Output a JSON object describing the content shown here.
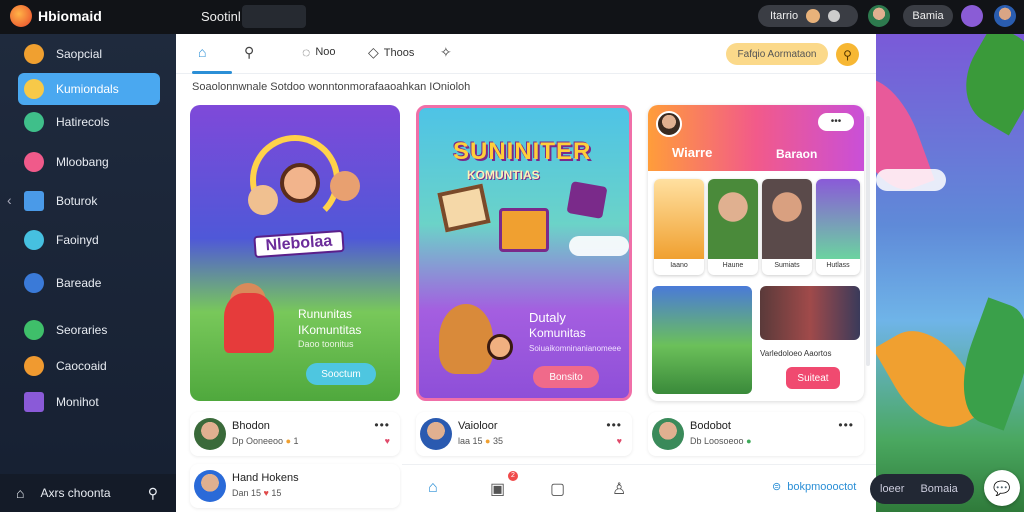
{
  "topbar": {
    "app_name": "Hbiomaid",
    "search_label": "Sootinl",
    "profile_pill": "Itarrio",
    "pill2": "Bamia"
  },
  "sidebar": {
    "items": [
      {
        "label": "Saopcial",
        "color": "#f0a030"
      },
      {
        "label": "Kumiondals",
        "color": "#f7c948"
      },
      {
        "label": "Hatirecols",
        "color": "#3fbf8a"
      },
      {
        "label": "Mloobang",
        "color": "#f05a8a"
      },
      {
        "label": "Boturok",
        "color": "#4a9ae8"
      },
      {
        "label": "Faoinyd",
        "color": "#46c0e0"
      },
      {
        "label": "Bareade",
        "color": "#3a7ad8"
      },
      {
        "label": "Seoraries",
        "color": "#3fbf6a"
      },
      {
        "label": "Caocoaid",
        "color": "#f09a30"
      },
      {
        "label": "Monihot",
        "color": "#8a5ad8"
      }
    ],
    "bottom_label": "Axrs choonta"
  },
  "tabs": [
    {
      "label": "",
      "icon": "home-icon"
    },
    {
      "label": "",
      "icon": "search-icon"
    },
    {
      "label": "Noo",
      "icon": "chat-icon"
    },
    {
      "label": "Thoos",
      "icon": "comment-icon"
    },
    {
      "label": "",
      "icon": "sparkle-icon"
    }
  ],
  "header_right": {
    "yellow_pill": "Fafqio Aormataon"
  },
  "subheading": "Soaolonnwnale Sotdoo wonntonmorafaaoahkan IOnioloh",
  "cards": {
    "card1": {
      "title": "Nlebolaa",
      "line1": "Rununitas",
      "line2": "IKomuntitas",
      "line3": "Daoo toonitus",
      "button": "Sooctum"
    },
    "card2": {
      "title": "SUNINITER",
      "subtitle": "KOMUNTIAS",
      "line1": "Dutaly",
      "line2": "Komunitas",
      "line3": "Soiuaikomninanianomeee",
      "button": "Bonsito"
    },
    "card3": {
      "pill": "",
      "tag1": "Wiarre",
      "tag2": "Baraon",
      "thumbs": [
        "Iaano",
        "Haune",
        "Sumiats",
        "Hutlass"
      ],
      "caption": "Varledoloeo Aaortos",
      "button": "Suiteat"
    }
  },
  "feed": [
    {
      "name": "Bhodon",
      "meta": "Dp Ooneeoo",
      "count": "1"
    },
    {
      "name": "Vaioloor",
      "meta": "laa 15",
      "count": "35"
    },
    {
      "name": "Bodobot",
      "meta": "Db Loosoeoo",
      "count": ""
    },
    {
      "name": "Hand Hokens",
      "meta": "Dan 15",
      "count": "15"
    }
  ],
  "bottom_nav": {
    "badge": "2",
    "link": "bokpmoooctot"
  },
  "right": {
    "pill_a": "loeer",
    "pill_b": "Bomaia"
  }
}
